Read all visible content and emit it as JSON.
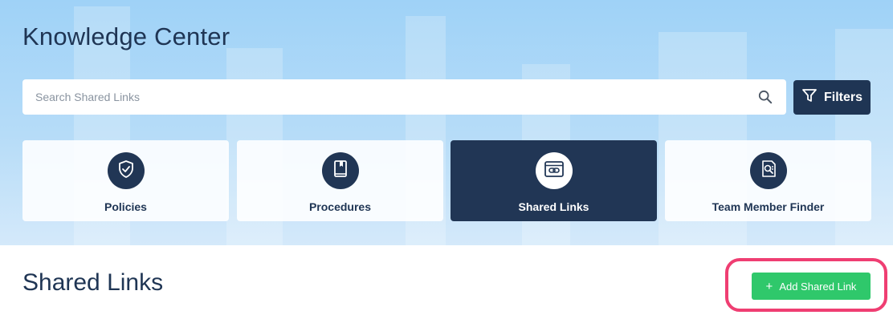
{
  "page_title": "Knowledge Center",
  "search": {
    "placeholder": "Search Shared Links",
    "value": "",
    "icon": "search-icon"
  },
  "filters_button": {
    "label": "Filters",
    "icon": "funnel-icon"
  },
  "categories": [
    {
      "label": "Policies",
      "icon": "shield-check-icon",
      "active": false
    },
    {
      "label": "Procedures",
      "icon": "book-icon",
      "active": false
    },
    {
      "label": "Shared Links",
      "icon": "link-window-icon",
      "active": true
    },
    {
      "label": "Team Member Finder",
      "icon": "person-search-icon",
      "active": false
    }
  ],
  "section_title": "Shared Links",
  "add_button": {
    "label": "Add Shared Link",
    "icon": "plus-icon"
  },
  "colors": {
    "navy": "#213655",
    "green": "#2fc86b",
    "highlight": "#ef3e72",
    "hero_blue": "#9fd2f7"
  }
}
